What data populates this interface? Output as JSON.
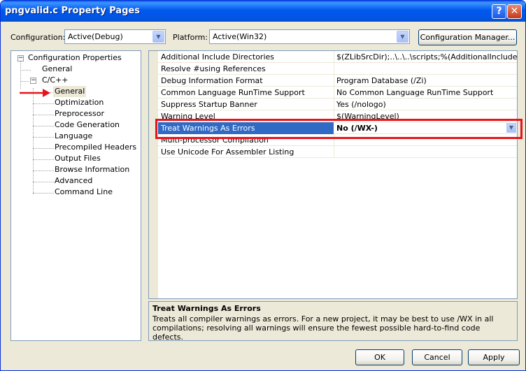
{
  "window": {
    "title": "pngvalid.c Property Pages",
    "help_glyph": "?",
    "close_glyph": "✕"
  },
  "top": {
    "configuration_label": "Configuration:",
    "configuration_value": "Active(Debug)",
    "platform_label": "Platform:",
    "platform_value": "Active(Win32)",
    "config_manager_label": "Configuration Manager..."
  },
  "tree": {
    "root": "Configuration Properties",
    "general": "General",
    "cpp": "C/C++",
    "children": [
      "General",
      "Optimization",
      "Preprocessor",
      "Code Generation",
      "Language",
      "Precompiled Headers",
      "Output Files",
      "Browse Information",
      "Advanced",
      "Command Line"
    ],
    "selected": "General"
  },
  "properties": [
    {
      "name": "Additional Include Directories",
      "value": "$(ZLibSrcDir);..\\..\\..\\scripts;%(AdditionalIncludeDirector"
    },
    {
      "name": "Resolve #using References",
      "value": ""
    },
    {
      "name": "Debug Information Format",
      "value": "Program Database (/Zi)"
    },
    {
      "name": "Common Language RunTime Support",
      "value": "No Common Language RunTime Support"
    },
    {
      "name": "Suppress Startup Banner",
      "value": "Yes (/nologo)"
    },
    {
      "name": "Warning Level",
      "value": "$(WarningLevel)"
    },
    {
      "name": "Treat Warnings As Errors",
      "value": "No (/WX-)"
    },
    {
      "name": "Multi-processor Compilation",
      "value": ""
    },
    {
      "name": "Use Unicode For Assembler Listing",
      "value": ""
    }
  ],
  "selected_property_index": 6,
  "description": {
    "title": "Treat Warnings As Errors",
    "text": "Treats all compiler warnings as errors. For a new project, it may be best to use /WX in all compilations; resolving all warnings will ensure the fewest possible hard-to-find code defects."
  },
  "buttons": {
    "ok": "OK",
    "cancel": "Cancel",
    "apply": "Apply"
  },
  "colors": {
    "title_bar": "#0054E3",
    "selection": "#316AC5",
    "annotation": "#E8141B",
    "dialog_bg": "#ECE9D8"
  }
}
